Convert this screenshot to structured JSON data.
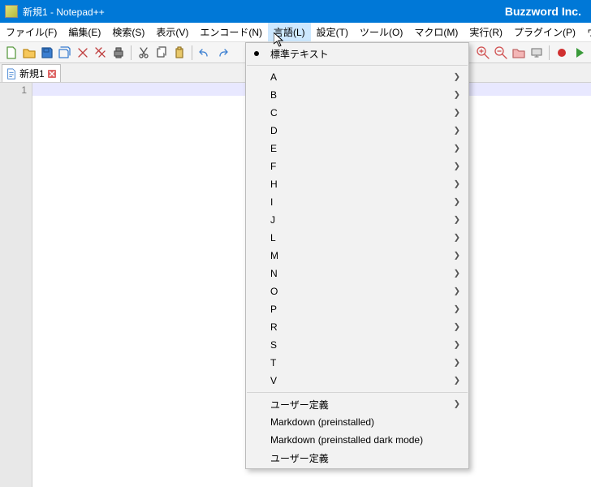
{
  "titlebar": {
    "title": "新規1 - Notepad++",
    "brand": "Buzzword Inc."
  },
  "menubar": {
    "items": [
      {
        "label": "ファイル(F)",
        "name": "menu-file"
      },
      {
        "label": "編集(E)",
        "name": "menu-edit"
      },
      {
        "label": "検索(S)",
        "name": "menu-search"
      },
      {
        "label": "表示(V)",
        "name": "menu-view"
      },
      {
        "label": "エンコード(N)",
        "name": "menu-encoding"
      },
      {
        "label": "言語(L)",
        "name": "menu-language",
        "open": true
      },
      {
        "label": "設定(T)",
        "name": "menu-settings"
      },
      {
        "label": "ツール(O)",
        "name": "menu-tools"
      },
      {
        "label": "マクロ(M)",
        "name": "menu-macro"
      },
      {
        "label": "実行(R)",
        "name": "menu-run"
      },
      {
        "label": "プラグイン(P)",
        "name": "menu-plugins"
      },
      {
        "label": "ウィンドウ管理(W",
        "name": "menu-window"
      }
    ]
  },
  "toolbar": {
    "groups": [
      [
        {
          "name": "new-icon",
          "svg": "file"
        },
        {
          "name": "open-icon",
          "svg": "folder"
        },
        {
          "name": "save-icon",
          "svg": "save"
        },
        {
          "name": "saveall-icon",
          "svg": "saveall"
        },
        {
          "name": "close-icon",
          "svg": "close"
        },
        {
          "name": "closeall-icon",
          "svg": "closeall"
        },
        {
          "name": "print-icon",
          "svg": "print"
        }
      ],
      [
        {
          "name": "cut-icon",
          "svg": "cut"
        },
        {
          "name": "copy-icon",
          "svg": "copy"
        },
        {
          "name": "paste-icon",
          "svg": "paste"
        }
      ],
      [
        {
          "name": "undo-icon",
          "svg": "undo"
        },
        {
          "name": "redo-icon",
          "svg": "redo"
        }
      ]
    ],
    "right_groups": [
      [
        {
          "name": "zoom-in-icon",
          "svg": "zoomin"
        },
        {
          "name": "zoom-out-icon",
          "svg": "zoomout"
        },
        {
          "name": "folder-icon",
          "svg": "folder2"
        },
        {
          "name": "monitor-icon",
          "svg": "monitor"
        }
      ],
      [
        {
          "name": "record-icon",
          "svg": "record"
        },
        {
          "name": "play-icon",
          "svg": "play"
        }
      ]
    ]
  },
  "tabs": {
    "items": [
      {
        "label": "新規1",
        "name": "tab-new1"
      }
    ]
  },
  "editor": {
    "line_numbers": [
      "1"
    ]
  },
  "language_menu": {
    "top": {
      "label": "標準テキスト",
      "checked": true
    },
    "letters": [
      "A",
      "B",
      "C",
      "D",
      "E",
      "F",
      "H",
      "I",
      "J",
      "L",
      "M",
      "N",
      "O",
      "P",
      "R",
      "S",
      "T",
      "V"
    ],
    "bottom": [
      {
        "label": "ユーザー定義",
        "submenu": true
      },
      {
        "label": "Markdown (preinstalled)",
        "submenu": false
      },
      {
        "label": "Markdown (preinstalled dark mode)",
        "submenu": false
      },
      {
        "label": "ユーザー定義",
        "submenu": false
      }
    ]
  }
}
